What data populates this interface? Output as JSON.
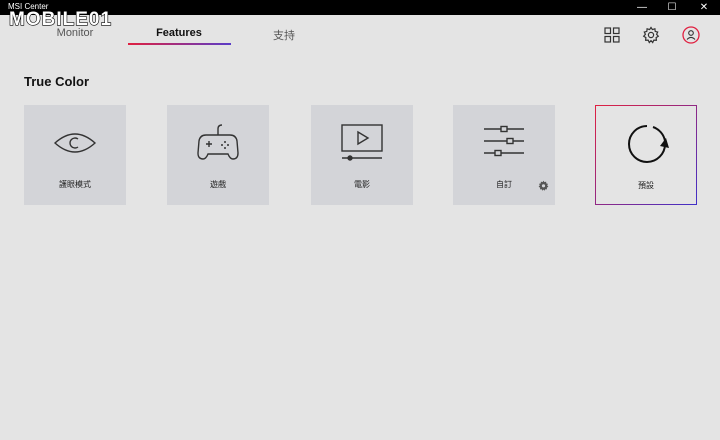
{
  "app": {
    "title": "MSI Center",
    "watermark": "MOBILE01"
  },
  "window_controls": {
    "minimize": "—",
    "maximize": "☐",
    "close": "✕"
  },
  "tabs": [
    {
      "label": "Monitor",
      "active": false
    },
    {
      "label": "Features",
      "active": true
    },
    {
      "label": "支持",
      "active": false
    }
  ],
  "header_icons": [
    "grid-icon",
    "gear-icon",
    "user-icon"
  ],
  "section": {
    "title": "True Color"
  },
  "modes": [
    {
      "label": "護眼模式",
      "icon": "eye-icon",
      "selected": false
    },
    {
      "label": "遊戲",
      "icon": "gamepad-icon",
      "selected": false
    },
    {
      "label": "電影",
      "icon": "video-icon",
      "selected": false
    },
    {
      "label": "自訂",
      "icon": "sliders-icon",
      "selected": false,
      "has_settings": true
    },
    {
      "label": "預設",
      "icon": "reset-icon",
      "selected": true
    }
  ],
  "colors": {
    "accent_red": "#e02040",
    "accent_blue": "#4030c8",
    "card_bg": "#d3d4d8",
    "page_bg": "#e4e4e4"
  }
}
